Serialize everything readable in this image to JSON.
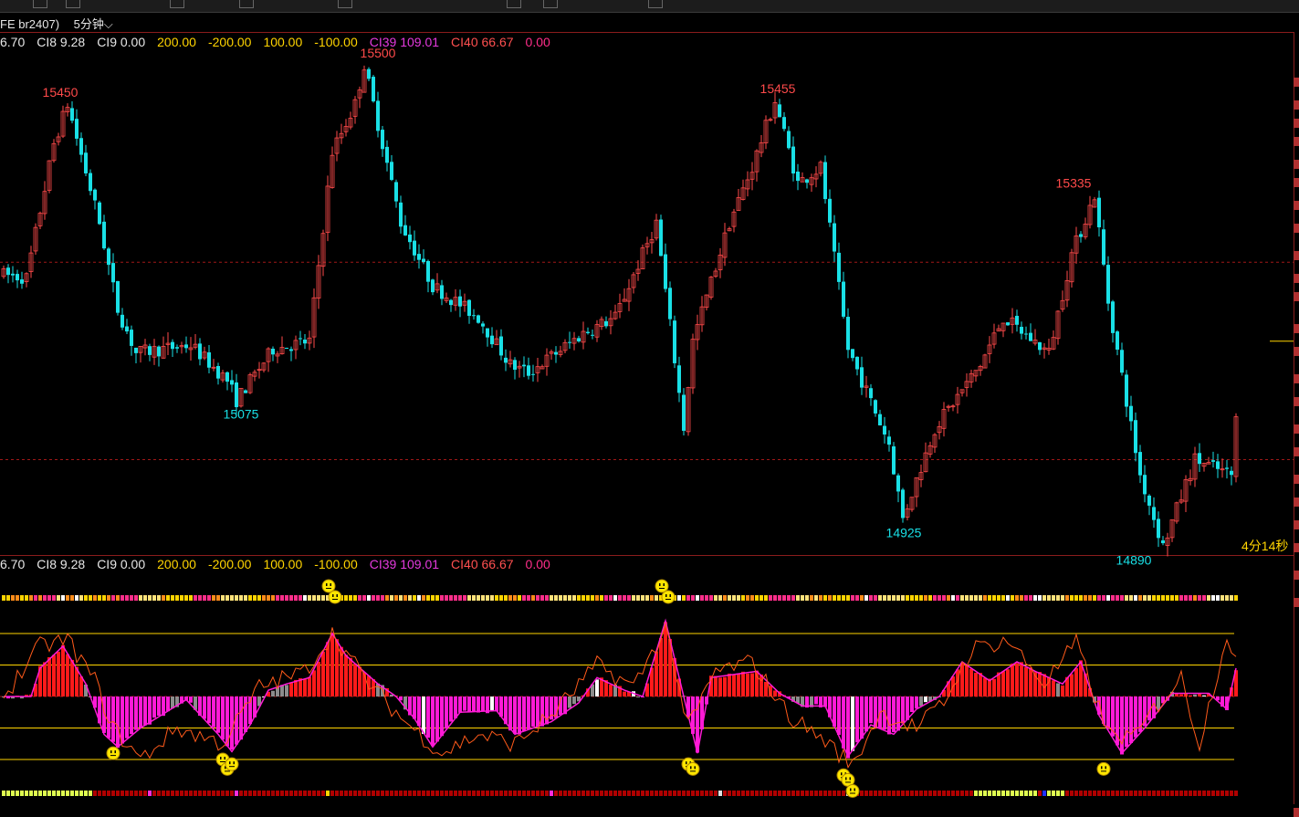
{
  "header": {
    "contract": "FE br2407)",
    "period": "5分钟",
    "period_arrow": "chevron-down-icon"
  },
  "indicator_row": [
    {
      "text": "6.70",
      "color": "#e6e6e6"
    },
    {
      "text": "CI8 9.28",
      "color": "#e6e6e6"
    },
    {
      "text": "CI9 0.00",
      "color": "#e6e6e6"
    },
    {
      "text": "200.00",
      "color": "#ffd400"
    },
    {
      "text": "-200.00",
      "color": "#ffd400"
    },
    {
      "text": "100.00",
      "color": "#ffd400"
    },
    {
      "text": "-100.00",
      "color": "#ffd400"
    },
    {
      "text": "CI39 109.01",
      "color": "#e53adf"
    },
    {
      "text": "CI40 66.67",
      "color": "#ff5050"
    },
    {
      "text": "0.00",
      "color": "#ff2e8a"
    }
  ],
  "countdown": "4分14秒",
  "colors": {
    "up": "#ff4a4a",
    "down": "#19e0e6",
    "high_label": "#ff4a4a",
    "low_label": "#19e0e6",
    "pos_hist": "#ff1a1a",
    "neg_hist": "#ff1ad6",
    "gray_hist": "#8c8c8c",
    "level_line": "#ffd400",
    "grid_dash": "#a01818",
    "smiley": "#ffe600"
  },
  "chart_data": [
    {
      "type": "candlestick",
      "title": "",
      "price_labels": [
        {
          "text": "15450",
          "value": 15450,
          "kind": "high"
        },
        {
          "text": "15500",
          "value": 15500,
          "kind": "high"
        },
        {
          "text": "15075",
          "value": 15075,
          "kind": "low"
        },
        {
          "text": "15455",
          "value": 15455,
          "kind": "high"
        },
        {
          "text": "14925",
          "value": 14925,
          "kind": "low"
        },
        {
          "text": "15335",
          "value": 15335,
          "kind": "high"
        },
        {
          "text": "14890",
          "value": 14890,
          "kind": "low"
        }
      ],
      "anchors": [
        [
          0,
          15235
        ],
        [
          6,
          15230
        ],
        [
          12,
          15400
        ],
        [
          15,
          15450
        ],
        [
          22,
          15300
        ],
        [
          26,
          15190
        ],
        [
          30,
          15135
        ],
        [
          42,
          15145
        ],
        [
          50,
          15100
        ],
        [
          52,
          15075
        ],
        [
          60,
          15140
        ],
        [
          68,
          15150
        ],
        [
          73,
          15390
        ],
        [
          78,
          15450
        ],
        [
          80,
          15500
        ],
        [
          88,
          15300
        ],
        [
          95,
          15220
        ],
        [
          105,
          15180
        ],
        [
          112,
          15120
        ],
        [
          116,
          15110
        ],
        [
          128,
          15160
        ],
        [
          135,
          15180
        ],
        [
          144,
          15300
        ],
        [
          150,
          15040
        ],
        [
          152,
          15150
        ],
        [
          160,
          15300
        ],
        [
          165,
          15370
        ],
        [
          170,
          15455
        ],
        [
          175,
          15350
        ],
        [
          180,
          15370
        ],
        [
          186,
          15140
        ],
        [
          195,
          15020
        ],
        [
          198,
          14925
        ],
        [
          205,
          15040
        ],
        [
          215,
          15120
        ],
        [
          220,
          15180
        ],
        [
          230,
          15135
        ],
        [
          235,
          15260
        ],
        [
          240,
          15335
        ],
        [
          243,
          15200
        ],
        [
          250,
          14980
        ],
        [
          255,
          14890
        ],
        [
          262,
          15000
        ],
        [
          270,
          14980
        ],
        [
          270,
          15050
        ]
      ],
      "candle_count": 271,
      "ylim": [
        14885,
        15530
      ],
      "yref_lines": [
        15250,
        15000
      ],
      "last_price_marker": 15150
    },
    {
      "type": "histogram_oscillator",
      "title": "",
      "levels": [
        200,
        100,
        0,
        -100,
        -200
      ],
      "ylim": [
        -320,
        320
      ],
      "hist_anchors": [
        [
          0,
          0
        ],
        [
          6,
          0
        ],
        [
          8,
          90
        ],
        [
          13,
          160
        ],
        [
          18,
          40
        ],
        [
          22,
          -120
        ],
        [
          25,
          -160
        ],
        [
          30,
          -100
        ],
        [
          40,
          -10
        ],
        [
          47,
          -120
        ],
        [
          50,
          -175
        ],
        [
          54,
          -90
        ],
        [
          58,
          20
        ],
        [
          62,
          40
        ],
        [
          67,
          60
        ],
        [
          72,
          200
        ],
        [
          75,
          130
        ],
        [
          82,
          40
        ],
        [
          86,
          0
        ],
        [
          90,
          -70
        ],
        [
          94,
          -160
        ],
        [
          100,
          -50
        ],
        [
          108,
          -45
        ],
        [
          112,
          -120
        ],
        [
          120,
          -80
        ],
        [
          126,
          -20
        ],
        [
          130,
          60
        ],
        [
          136,
          20
        ],
        [
          140,
          0
        ],
        [
          145,
          240
        ],
        [
          149,
          0
        ],
        [
          152,
          -180
        ],
        [
          155,
          60
        ],
        [
          165,
          80
        ],
        [
          170,
          10
        ],
        [
          175,
          -30
        ],
        [
          180,
          -30
        ],
        [
          185,
          -190
        ],
        [
          190,
          -90
        ],
        [
          195,
          -120
        ],
        [
          200,
          -40
        ],
        [
          205,
          0
        ],
        [
          210,
          110
        ],
        [
          216,
          50
        ],
        [
          222,
          110
        ],
        [
          226,
          80
        ],
        [
          232,
          40
        ],
        [
          236,
          110
        ],
        [
          240,
          -60
        ],
        [
          245,
          -180
        ],
        [
          250,
          -100
        ],
        [
          256,
          10
        ],
        [
          264,
          10
        ],
        [
          268,
          -40
        ],
        [
          270,
          90
        ]
      ],
      "line_anchors": [
        [
          0,
          0
        ],
        [
          8,
          160
        ],
        [
          14,
          180
        ],
        [
          20,
          50
        ],
        [
          24,
          -100
        ],
        [
          30,
          -200
        ],
        [
          38,
          -100
        ],
        [
          48,
          -150
        ],
        [
          56,
          30
        ],
        [
          62,
          60
        ],
        [
          66,
          80
        ],
        [
          72,
          200
        ],
        [
          80,
          40
        ],
        [
          88,
          -80
        ],
        [
          96,
          -180
        ],
        [
          104,
          -120
        ],
        [
          112,
          -150
        ],
        [
          120,
          -60
        ],
        [
          130,
          100
        ],
        [
          138,
          30
        ],
        [
          145,
          220
        ],
        [
          150,
          -100
        ],
        [
          156,
          80
        ],
        [
          164,
          110
        ],
        [
          172,
          -60
        ],
        [
          180,
          -140
        ],
        [
          186,
          -220
        ],
        [
          192,
          -50
        ],
        [
          200,
          -100
        ],
        [
          206,
          -20
        ],
        [
          212,
          150
        ],
        [
          220,
          180
        ],
        [
          228,
          40
        ],
        [
          235,
          170
        ],
        [
          242,
          -120
        ],
        [
          248,
          -130
        ],
        [
          252,
          -40
        ],
        [
          258,
          60
        ],
        [
          262,
          -150
        ],
        [
          268,
          200
        ],
        [
          270,
          120
        ]
      ],
      "smileys": [
        {
          "x": 72,
          "level": "top"
        },
        {
          "x": 145,
          "level": "top"
        },
        {
          "x": 24,
          "level": -180
        },
        {
          "x": 48,
          "level": -200
        },
        {
          "x": 49,
          "level": -230
        },
        {
          "x": 50,
          "level": -215
        },
        {
          "x": 150,
          "level": -215
        },
        {
          "x": 151,
          "level": -230
        },
        {
          "x": 184,
          "level": -250
        },
        {
          "x": 185,
          "level": -265
        },
        {
          "x": 186,
          "level": -300
        },
        {
          "x": 241,
          "level": -230
        }
      ],
      "signal_strips": [
        "top",
        "bottom"
      ]
    }
  ]
}
